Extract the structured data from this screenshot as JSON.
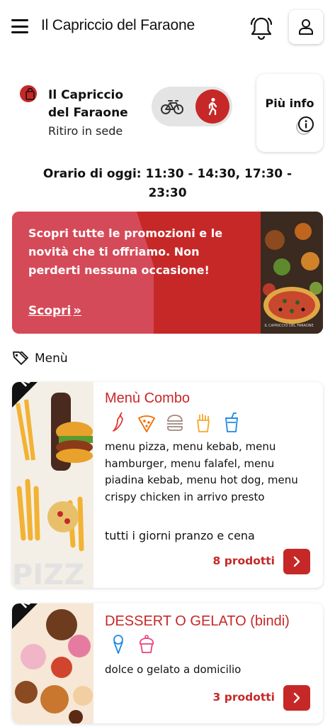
{
  "header": {
    "title": "Il Capriccio del Faraone",
    "menu_icon": "hamburger-icon",
    "notification_icon": "bell-icon",
    "account_icon": "user-icon"
  },
  "store": {
    "name": "Il Capriccio del Faraone",
    "mode": "Ritiro in sede",
    "info_label": "Più info",
    "hours": "Orario di oggi: 11:30 - 14:30, 17:30 - 23:30"
  },
  "delivery_toggle": {
    "options": [
      "bike-icon",
      "walking-icon"
    ],
    "selected": "walking-icon"
  },
  "promo": {
    "text": "Scopri tutte le promozioni e le novità che ti offriamo. Non perderti nessuna occasione!",
    "cta": "Scopri",
    "cta_arrow": "»",
    "image_caption": "IL CAPRICCIO DEL FARAONE"
  },
  "section": {
    "label": "Menù"
  },
  "menus": [
    {
      "badge": "NEW NE",
      "title": "Menù Combo",
      "icons": [
        "chili-icon",
        "pizza-icon",
        "burger-icon",
        "fries-icon",
        "drink-icon"
      ],
      "description": "menu pizza, menu kebab, menu hamburger, menu falafel, menu piadina kebab, menu hot dog, menu crispy chicken in arrivo presto",
      "availability": "tutti i giorni pranzo e cena",
      "count": "8 prodotti"
    },
    {
      "badge": "NEW NE",
      "title": "DESSERT O GELATO (bindi)",
      "icons": [
        "ice-cream-icon",
        "cupcake-icon"
      ],
      "description": "dolce o gelato a domicilio",
      "availability": "",
      "count": "3 prodotti"
    }
  ],
  "colors": {
    "brand_red": "#c62828",
    "icon_red": "#e53935",
    "icon_orange": "#ef6c00",
    "icon_brown": "#a1887f",
    "icon_yellow": "#f9a825",
    "icon_blue": "#1e88e5",
    "icon_pink": "#ec407a"
  }
}
